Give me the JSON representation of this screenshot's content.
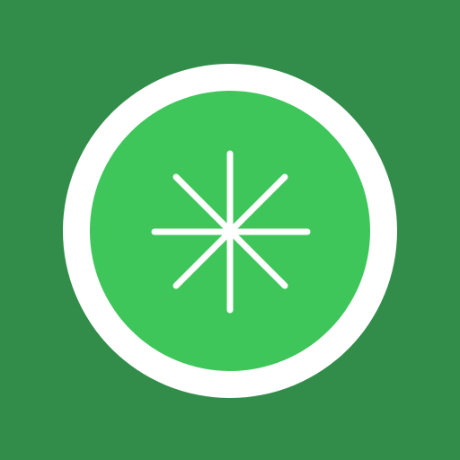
{
  "icon": {
    "name": "asterisk-icon",
    "colors": {
      "background": "#338d4a",
      "ring": "#ffffff",
      "disc": "#3fc65b",
      "glyph": "#ffffff"
    }
  }
}
